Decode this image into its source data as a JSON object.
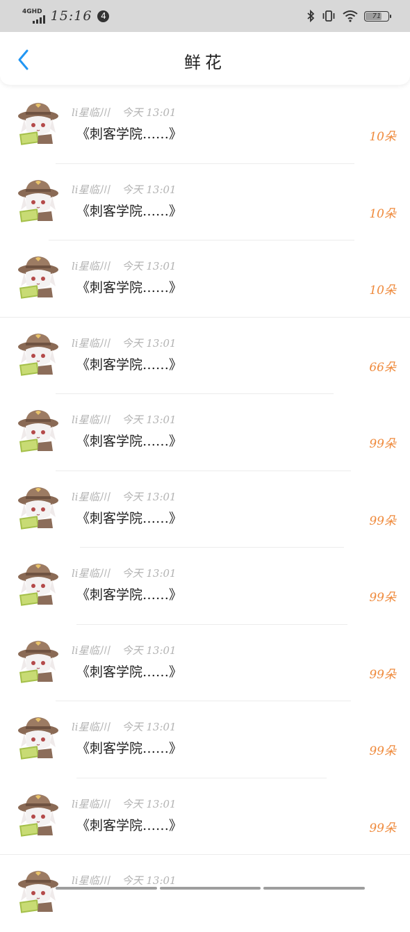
{
  "status_bar": {
    "network_type": "4GHD",
    "time": "15:16",
    "notification_count": "4",
    "battery_level": "71",
    "icons": [
      "signal-icon",
      "bluetooth-icon",
      "vibrate-icon",
      "wifi-icon",
      "battery-icon"
    ]
  },
  "nav": {
    "title": "鲜花",
    "back_icon": "chevron-left-icon",
    "accent_color": "#2196f3"
  },
  "colors": {
    "amount": "#ef8a3c",
    "meta": "#b3b3b3"
  },
  "items": [
    {
      "user": "li星临川",
      "time": "今天 13:01",
      "title": "《刺客学院……》",
      "amount": "10朵"
    },
    {
      "user": "li星临川",
      "time": "今天 13:01",
      "title": "《刺客学院……》",
      "amount": "10朵"
    },
    {
      "user": "li星临川",
      "time": "今天 13:01",
      "title": "《刺客学院……》",
      "amount": "10朵"
    },
    {
      "user": "li星临川",
      "time": "今天 13:01",
      "title": "《刺客学院……》",
      "amount": "66朵"
    },
    {
      "user": "li星临川",
      "time": "今天 13:01",
      "title": "《刺客学院……》",
      "amount": "99朵"
    },
    {
      "user": "li星临川",
      "time": "今天 13:01",
      "title": "《刺客学院……》",
      "amount": "99朵"
    },
    {
      "user": "li星临川",
      "time": "今天 13:01",
      "title": "《刺客学院……》",
      "amount": "99朵"
    },
    {
      "user": "li星临川",
      "time": "今天 13:01",
      "title": "《刺客学院……》",
      "amount": "99朵"
    },
    {
      "user": "li星临川",
      "time": "今天 13:01",
      "title": "《刺客学院……》",
      "amount": "99朵"
    },
    {
      "user": "li星临川",
      "time": "今天 13:01",
      "title": "《刺客学院……》",
      "amount": "99朵"
    },
    {
      "user": "li星临川",
      "time": "今天 13:01",
      "title": "",
      "amount": ""
    }
  ]
}
